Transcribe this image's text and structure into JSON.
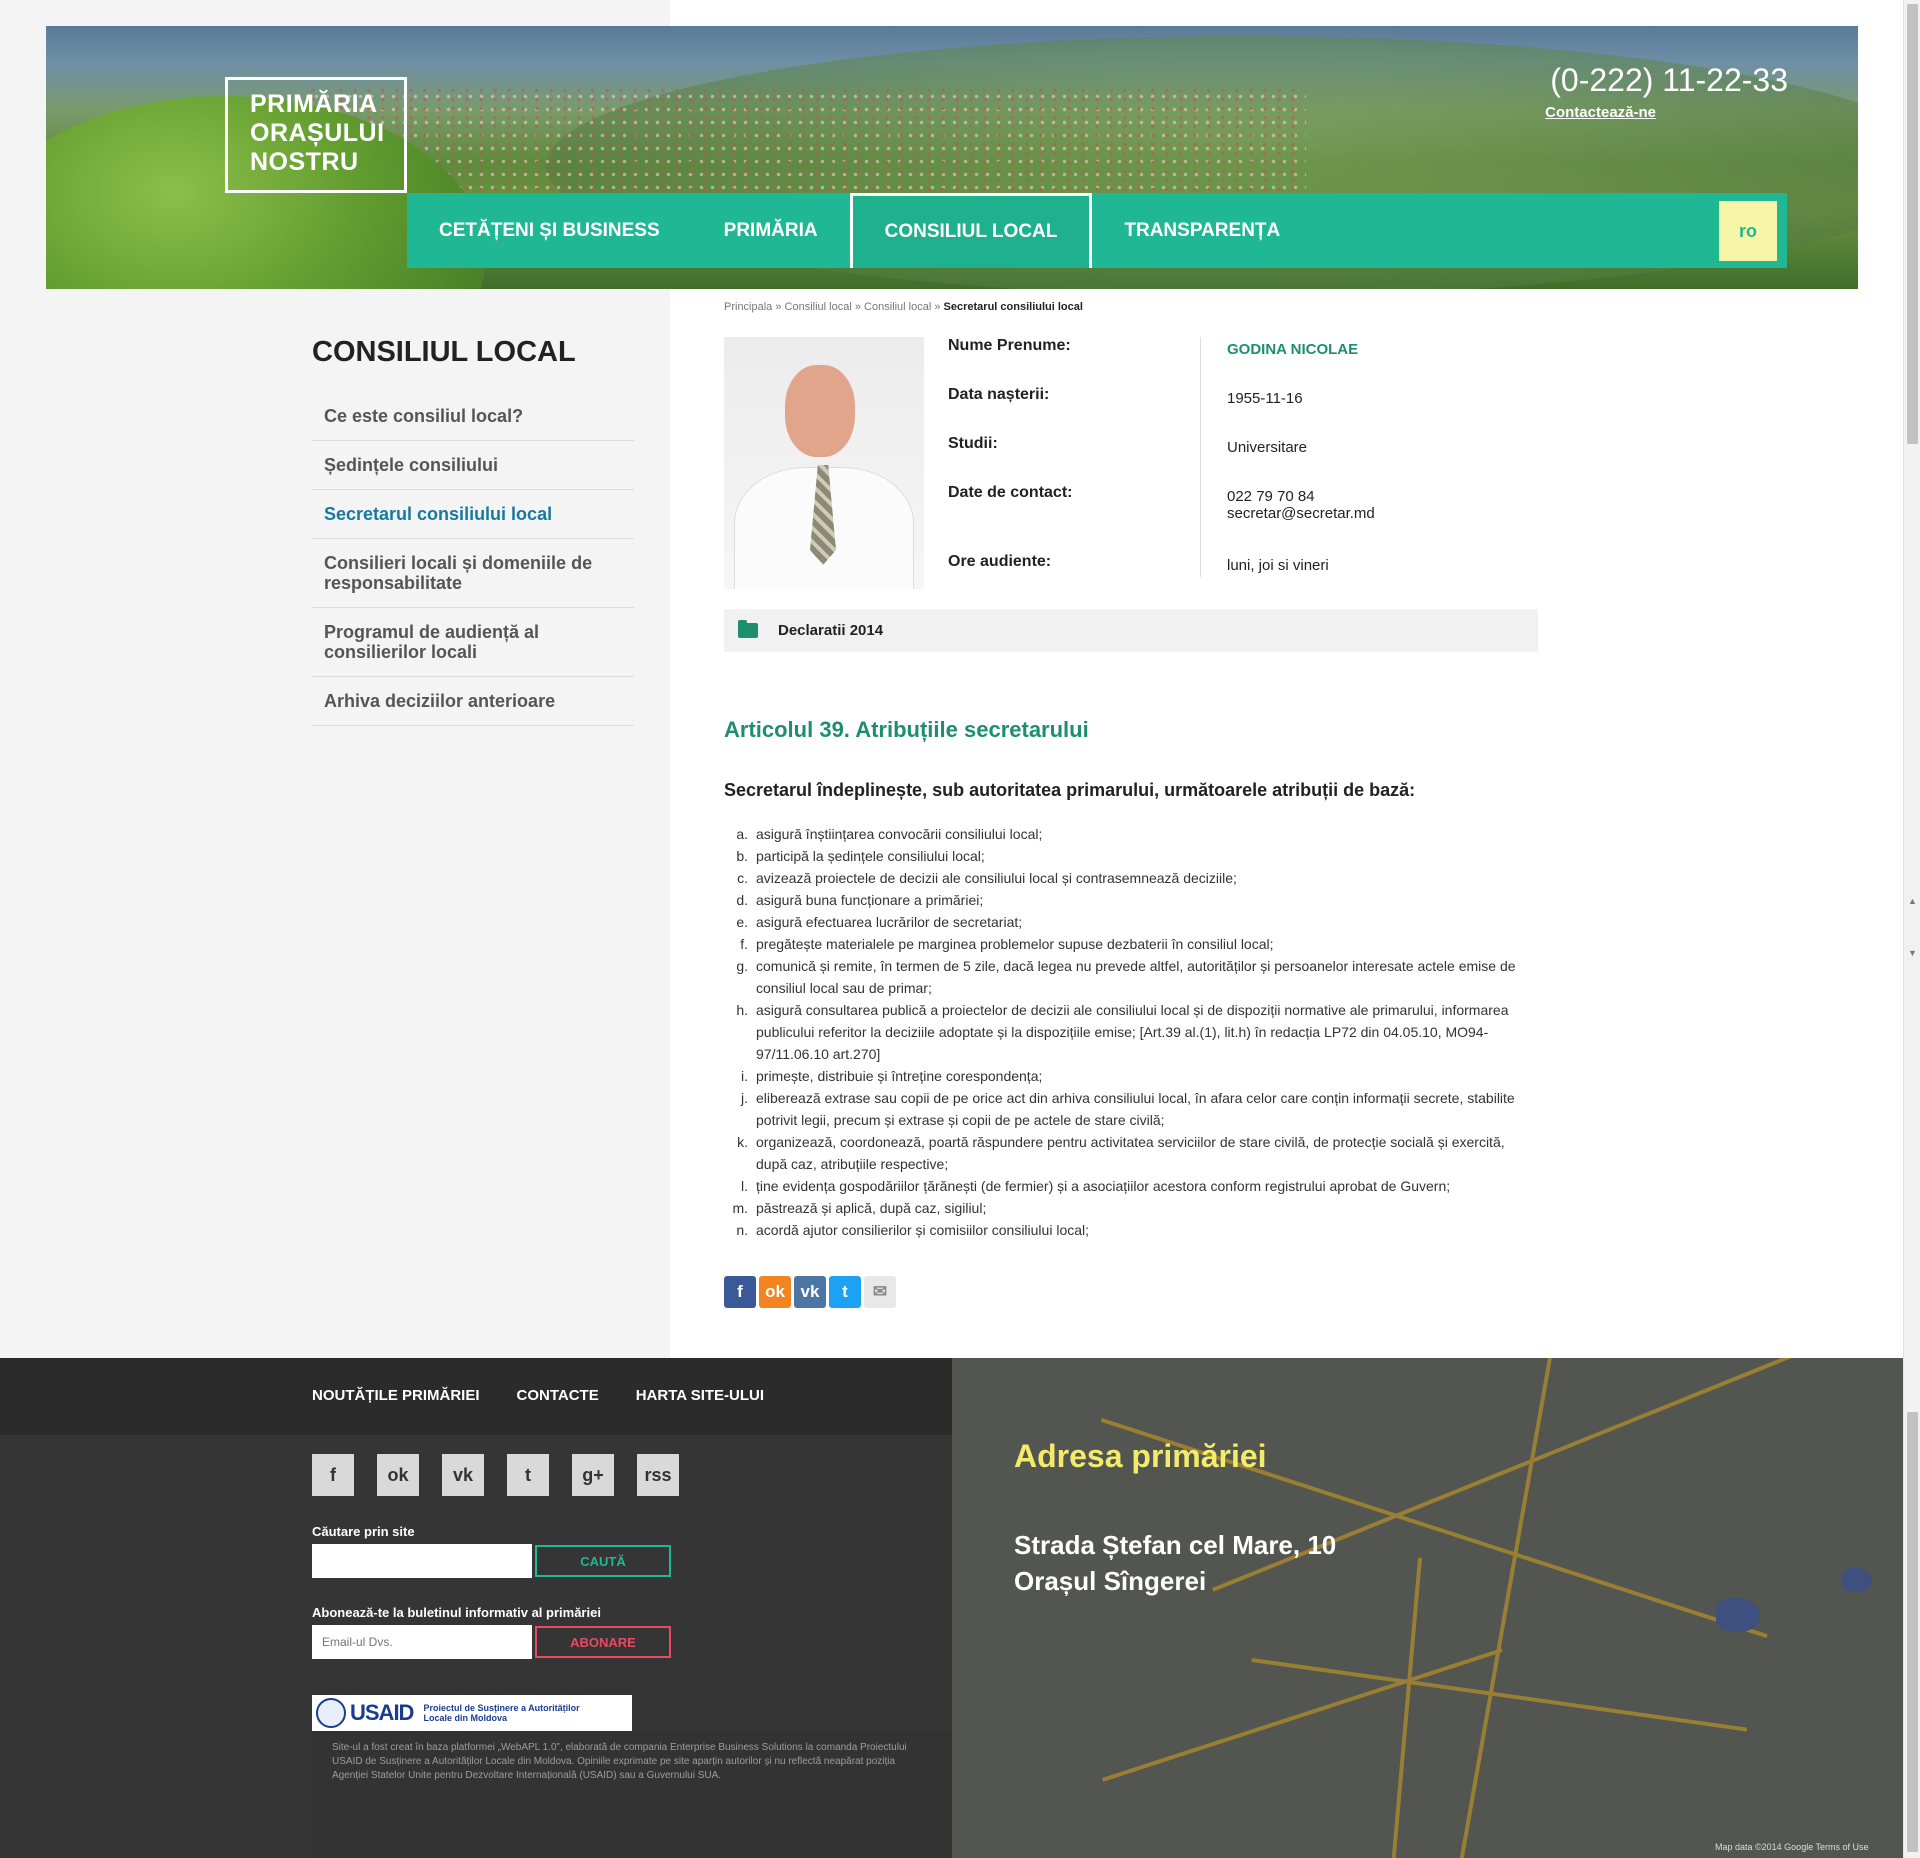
{
  "header": {
    "logo_lines": [
      "PRIMĂRIA",
      "ORAȘULUI",
      "NOSTRU"
    ],
    "phone": "(0-222) 11-22-33",
    "contact_link": "Contactează-ne",
    "nav": [
      "CETĂȚENI ȘI BUSINESS",
      "PRIMĂRIA",
      "CONSILIUL LOCAL",
      "TRANSPARENȚA"
    ],
    "language": "ro"
  },
  "breadcrumb": {
    "items": [
      "Principala",
      "Consiliul local",
      "Consiliul local"
    ],
    "current": "Secretarul consiliului local",
    "separator": " » "
  },
  "sidebar": {
    "title": "CONSILIUL LOCAL",
    "items": [
      "Ce este consiliul local?",
      "Ședințele consiliului",
      "Secretarul consiliului local",
      "Consilieri locali și domeniile de responsabilitate",
      "Programul de audiență al consilierilor locali",
      "Arhiva deciziilor anterioare"
    ]
  },
  "profile": {
    "labels": [
      "Nume Prenume:",
      "Data nașterii:",
      "Studii:",
      "Date de contact:",
      "Ore audiente:"
    ],
    "name": "GODINA NICOLAE",
    "birth": "1955-11-16",
    "studies": "Universitare",
    "phone": "022 79 70 84",
    "email": "secretar@secretar.md",
    "hours": "luni, joi si vineri"
  },
  "declaration": "Declaratii 2014",
  "article": {
    "title": "Articolul 39. Atribuțiile secretarului",
    "intro": "Secretarul îndeplinește, sub autoritatea primarului, următoarele atribuții de bază:",
    "duties": [
      {
        "letter": "a.",
        "text": "asigură înștiințarea convocării consiliului local;"
      },
      {
        "letter": "b.",
        "text": "participă la ședințele consiliului local;"
      },
      {
        "letter": "c.",
        "text": "avizează proiectele de decizii ale consiliului local și contrasemnează deciziile;"
      },
      {
        "letter": "d.",
        "text": "asigură buna funcționare a primăriei;"
      },
      {
        "letter": "e.",
        "text": "asigură efectuarea lucrărilor de secretariat;"
      },
      {
        "letter": "f.",
        "text": "pregătește materialele pe marginea problemelor supuse dezbaterii în consiliul local;"
      },
      {
        "letter": "g.",
        "text": "comunică și remite, în termen de 5 zile, dacă legea nu prevede altfel, autorităților și persoanelor interesate actele emise de consiliul local sau de primar;"
      },
      {
        "letter": "h.",
        "text": "asigură consultarea publică a proiectelor de decizii ale consiliului local și de dispoziții normative ale primarului, informarea publicului referitor la deciziile adoptate și la dispozițiile emise; [Art.39 al.(1), lit.h) în redacția LP72 din 04.05.10,  MO94-97/11.06.10 art.270]"
      },
      {
        "letter": "i.",
        "text": "primește, distribuie și întreține corespondența;"
      },
      {
        "letter": "j.",
        "text": "eliberează extrase sau copii de pe orice act din arhiva consiliului local, în afara celor care conțin informații secrete, stabilite potrivit legii, precum și extrase și copii de pe actele de stare civilă;"
      },
      {
        "letter": "k.",
        "text": "organizează, coordonează, poartă răspundere pentru activitatea serviciilor de stare civilă, de protecție socială și exercită, după caz, atribuțiile respective;"
      },
      {
        "letter": "l.",
        "text": "ține evidența gospodăriilor țărănești (de fermier) și a asociațiilor acestora conform registrului aprobat de Guvern;"
      },
      {
        "letter": "m.",
        "text": "păstrează și aplică, după caz, sigiliul;"
      },
      {
        "letter": "n.",
        "text": "acordă ajutor consilierilor și comisiilor consiliului local;"
      }
    ]
  },
  "share": [
    {
      "icon": "facebook-icon",
      "glyph": "f",
      "color": "#3b5998"
    },
    {
      "icon": "odnoklassniki-icon",
      "glyph": "ok",
      "color": "#f48420"
    },
    {
      "icon": "vk-icon",
      "glyph": "vk",
      "color": "#4c75a3"
    },
    {
      "icon": "twitter-icon",
      "glyph": "t",
      "color": "#1da1f2"
    },
    {
      "icon": "email-icon",
      "glyph": "✉",
      "color": "#e8e8e8"
    }
  ],
  "footer": {
    "links": [
      "NOUTĂȚILE PRIMĂRIEI",
      "CONTACTE",
      "HARTA SITE-ULUI"
    ],
    "social": [
      {
        "icon": "facebook-icon",
        "glyph": "f"
      },
      {
        "icon": "odnoklassniki-icon",
        "glyph": "ok"
      },
      {
        "icon": "vk-icon",
        "glyph": "vk"
      },
      {
        "icon": "twitter-icon",
        "glyph": "t"
      },
      {
        "icon": "google-plus-icon",
        "glyph": "g+"
      },
      {
        "icon": "rss-icon",
        "glyph": "rss"
      }
    ],
    "search_label": "Căutare prin site",
    "search_value": "",
    "search_button": "CAUTĂ",
    "search_color": "#20b894",
    "subscribe_label": "Abonează-te la buletinul informativ al primăriei",
    "email_placeholder": "Email-ul Dvs.",
    "subscribe_button": "ABONARE",
    "subscribe_color": "#e84a5f",
    "usaid_brand": "USAID",
    "usaid_text": "Proiectul de Susținere a Autorităților Locale din Moldova",
    "disclaimer": "Site-ul a fost creat în baza platformei „WebAPL 1.0”, elaborată de compania Enterprise Business Solutions la comanda Proiectului USAID de Susținere a Autorităților Locale din Moldova. Opiniile exprimate pe site aparțin autorilor și nu reflectă neapărat poziția Agenției Statelor Unite pentru Dezvoltare Internațională (USAID) sau a Guvernului SUA."
  },
  "map": {
    "title": "Adresa primăriei",
    "address_line1": "Strada Ștefan cel Mare, 10",
    "address_line2": "Orașul Sîngerei",
    "credit": "Map data ©2014 Google   Terms of Use"
  },
  "colors": {
    "accent": "#20b894",
    "accent_dark": "#1e8f6e",
    "link_current": "#19789e",
    "map_title": "#f3ec6a"
  }
}
